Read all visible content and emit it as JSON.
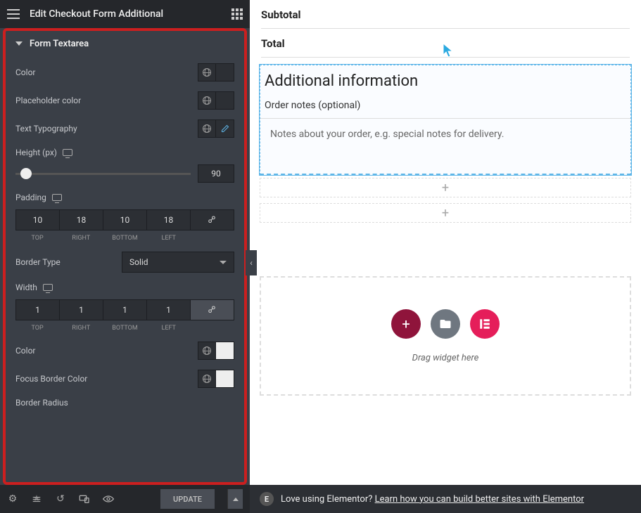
{
  "header": {
    "title": "Edit Checkout Form Additional"
  },
  "section": {
    "title": "Form Textarea"
  },
  "controls": {
    "color_label": "Color",
    "placeholder_color_label": "Placeholder color",
    "typography_label": "Text Typography",
    "height_label": "Height (px)",
    "height_value": "90",
    "padding_label": "Padding",
    "padding": {
      "top": "10",
      "right": "18",
      "bottom": "10",
      "left": "18"
    },
    "sides": {
      "top": "TOP",
      "right": "RIGHT",
      "bottom": "BOTTOM",
      "left": "LEFT"
    },
    "border_type_label": "Border Type",
    "border_type_value": "Solid",
    "width_label": "Width",
    "width": {
      "top": "1",
      "right": "1",
      "bottom": "1",
      "left": "1"
    },
    "border_color_label": "Color",
    "focus_border_color_label": "Focus Border Color",
    "border_radius_label": "Border Radius"
  },
  "footer": {
    "update": "Update"
  },
  "preview": {
    "subtotal": "Subtotal",
    "total": "Total",
    "info_heading": "Additional information",
    "order_notes_label": "Order notes (optional)",
    "order_notes_placeholder": "Notes about your order, e.g. special notes for delivery.",
    "drag_text": "Drag widget here",
    "banner_prefix": "Love using Elementor? ",
    "banner_link": "Learn how you can build better sites with Elementor"
  }
}
